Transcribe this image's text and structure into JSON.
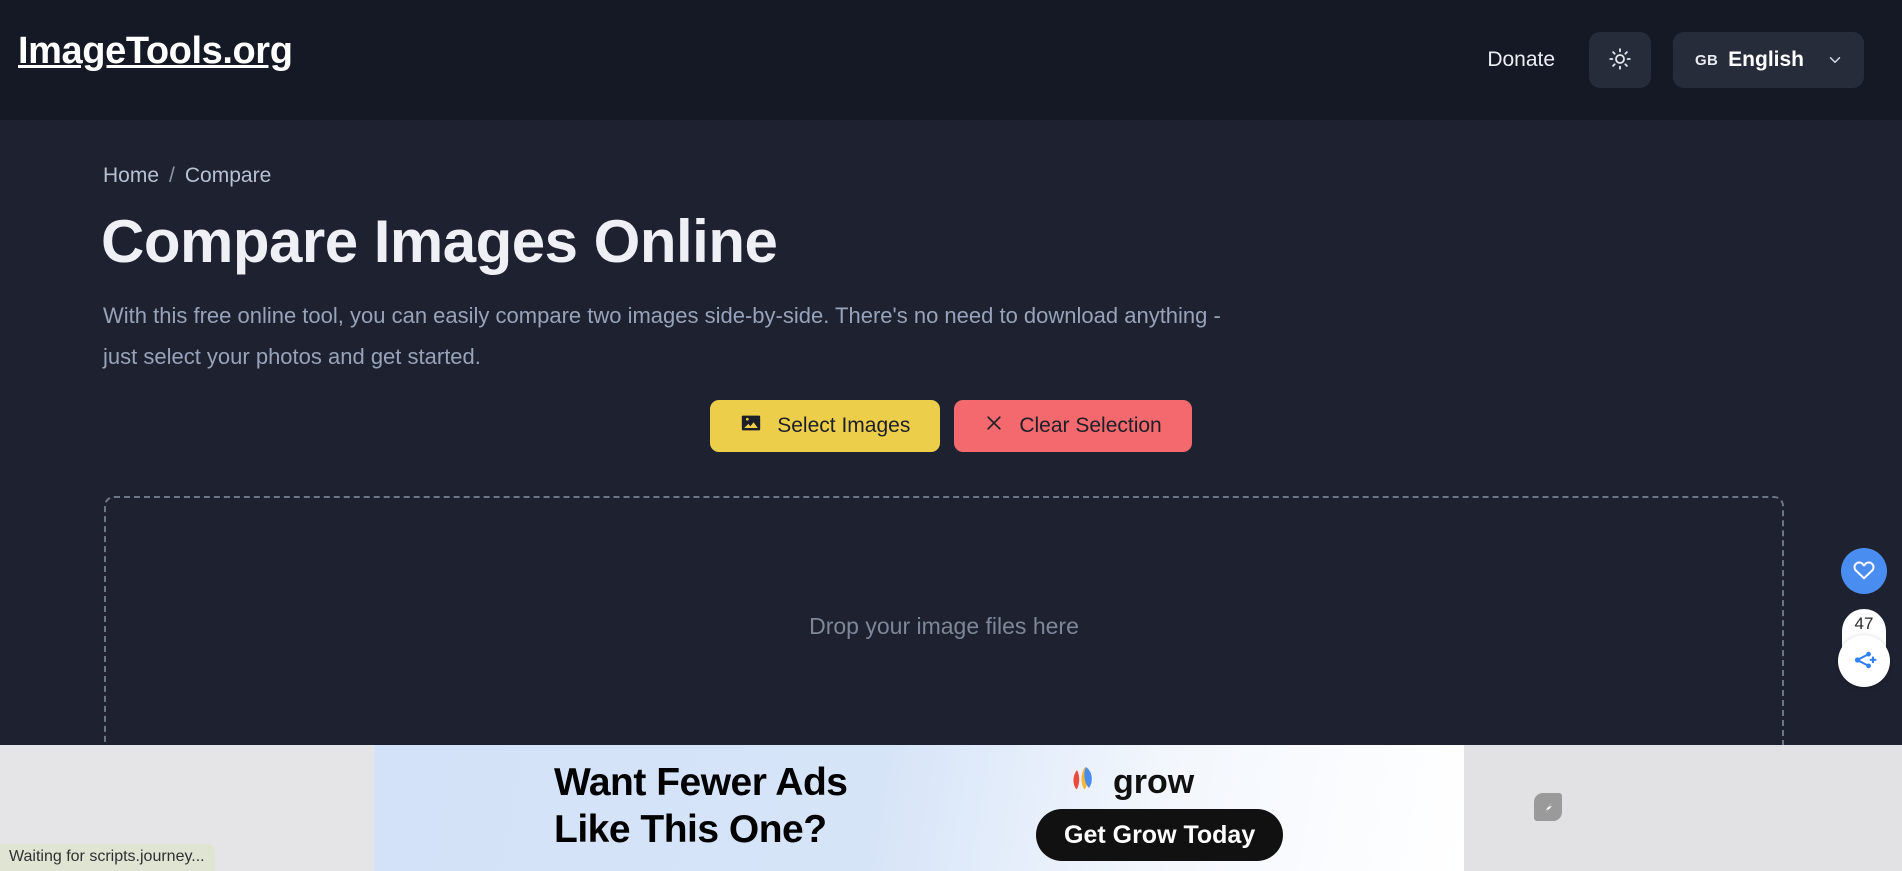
{
  "header": {
    "brand": "ImageTools.org",
    "donate_label": "Donate",
    "theme_toggle_icon": "sun-icon",
    "language": {
      "country_code": "GB",
      "name": "English",
      "chevron_icon": "chevron-down-icon"
    }
  },
  "breadcrumb": {
    "home": "Home",
    "separator": "/",
    "current": "Compare"
  },
  "page": {
    "title": "Compare Images Online",
    "description": "With this free online tool, you can easily compare two images side-by-side. There's no need to download anything - just select your photos and get started."
  },
  "actions": {
    "select_label": "Select Images",
    "select_icon": "image-icon",
    "clear_label": "Clear Selection",
    "clear_icon": "close-x-icon"
  },
  "dropzone": {
    "text": "Drop your image files here"
  },
  "side_widgets": {
    "favorite_icon": "heart-icon",
    "share_count": "47",
    "share_icon": "share-plus-icon"
  },
  "ad": {
    "headline_line1": "Want Fewer Ads",
    "headline_line2": "Like This One?",
    "brand": "grow",
    "brand_icon": "grow-leaves-icon",
    "cta_label": "Get Grow Today",
    "badge_icon": "ad-choices-icon"
  },
  "status": {
    "text": "Waiting for scripts.journey..."
  },
  "colors": {
    "header_bg": "#151925",
    "page_bg": "#1e2230",
    "accent_yellow": "#ecce4b",
    "accent_red": "#f4696d",
    "accent_blue": "#4a8df0",
    "ad_bg": "#d3e2f8"
  }
}
